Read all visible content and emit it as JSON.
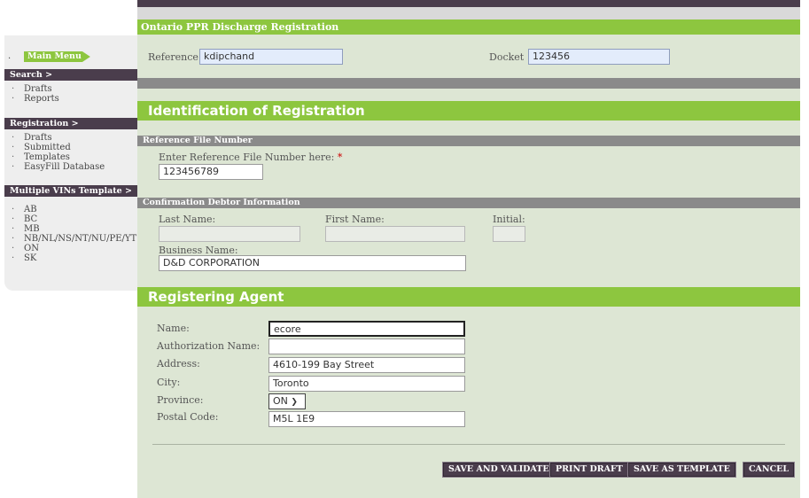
{
  "sidebar": {
    "main_menu": "Main Menu",
    "search_header": "Search >",
    "search_items": [
      "Drafts",
      "Reports"
    ],
    "registration_header": "Registration >",
    "registration_items": [
      "Drafts",
      "Submitted",
      "Templates",
      "EasyFill Database"
    ],
    "vins_header": "Multiple VINs Template >",
    "vins_items": [
      "AB",
      "BC",
      "MB",
      "NB/NL/NS/NT/NU/PE/YT",
      "ON",
      "SK"
    ]
  },
  "form": {
    "title": "Ontario PPR Discharge Registration",
    "reference_label": "Reference",
    "reference_value": "kdipchand",
    "docket_label": "Docket",
    "docket_value": "123456",
    "identification_title": "Identification of Registration",
    "ref_file_header": "Reference File Number",
    "ref_file_label": "Enter Reference File Number here:",
    "ref_file_required": "*",
    "ref_file_value": "123456789",
    "debtor_header": "Confirmation Debtor Information",
    "last_name_label": "Last Name:",
    "first_name_label": "First Name:",
    "initial_label": "Initial:",
    "business_name_label": "Business Name:",
    "business_name_value": "D&D CORPORATION",
    "agent_title": "Registering Agent",
    "agent": {
      "name_label": "Name:",
      "name_value": "ecore",
      "auth_label": "Authorization Name:",
      "auth_value": "",
      "address_label": "Address:",
      "address_value": "4610-199 Bay Street",
      "city_label": "City:",
      "city_value": "Toronto",
      "province_label": "Province:",
      "province_value": "ON",
      "postal_label": "Postal Code:",
      "postal_value": "M5L 1E9"
    }
  },
  "buttons": {
    "save_validate": "SAVE AND VALIDATE",
    "print_draft": "PRINT DRAFT",
    "save_template": "SAVE AS TEMPLATE",
    "cancel": "CANCEL"
  },
  "colors": {
    "accent_green": "#8dc63f",
    "header_purple": "#4a3d4c",
    "panel_bg": "#dde6d4"
  }
}
